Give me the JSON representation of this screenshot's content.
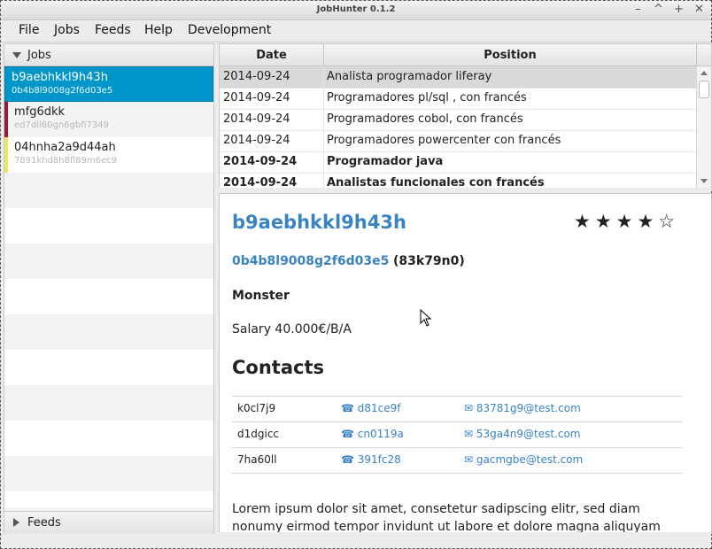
{
  "window": {
    "title": "JobHunter 0.1.2",
    "controls": [
      "–",
      "^",
      "+",
      "✕"
    ]
  },
  "menu": [
    "File",
    "Jobs",
    "Feeds",
    "Help",
    "Development"
  ],
  "sidebar": {
    "jobs_label": "Jobs",
    "feeds_label": "Feeds",
    "items": [
      {
        "title": "b9aebhkkl9h43h",
        "sub": "0b4b8l9008g2f6d03e5",
        "color": "#0096c9",
        "selected": true
      },
      {
        "title": "mfg6dkk",
        "sub": "ed7dll60gn6gbfi7349",
        "color": "#a0193c",
        "selected": false
      },
      {
        "title": "04hnha2a9d44ah",
        "sub": "7891khd8h8fl89m6ec9",
        "color": "#eaea55",
        "selected": false
      }
    ]
  },
  "table": {
    "headers": {
      "date": "Date",
      "position": "Position"
    },
    "rows": [
      {
        "date": "2014-09-24",
        "position": "Analista programador liferay",
        "bold": false,
        "selected": true
      },
      {
        "date": "2014-09-24",
        "position": "Programadores pl/sql , con francés",
        "bold": false,
        "selected": false
      },
      {
        "date": "2014-09-24",
        "position": "Programadores cobol,  con francés",
        "bold": false,
        "selected": false
      },
      {
        "date": "2014-09-24",
        "position": "Programadores powercenter con francés",
        "bold": false,
        "selected": false
      },
      {
        "date": "2014-09-24",
        "position": "Programador java",
        "bold": true,
        "selected": false
      },
      {
        "date": "2014-09-24",
        "position": "Analistas funcionales con francés",
        "bold": true,
        "selected": false
      }
    ]
  },
  "detail": {
    "title": "b9aebhkkl9h43h",
    "rating": 4,
    "stars": "★★★★☆",
    "id_link": "0b4b8l9008g2f6d03e5",
    "code": "(83k79n0)",
    "company": "Monster",
    "salary": "Salary 40.000€/B/A",
    "contacts_heading": "Contacts",
    "contacts": [
      {
        "name": "k0cl7j9",
        "phone": "☎ d81ce9f",
        "email": "✉ 83781g9@test.com"
      },
      {
        "name": "d1dgicc",
        "phone": "☎ cn0119a",
        "email": "✉ 53ga4n9@test.com"
      },
      {
        "name": "7ha60ll",
        "phone": "☎ 391fc28",
        "email": "✉ gacmgbe@test.com"
      }
    ],
    "description": "Lorem ipsum dolor sit amet, consetetur sadipscing elitr, sed diam nonumy eirmod tempor invidunt ut labore et dolore magna aliquyam"
  }
}
